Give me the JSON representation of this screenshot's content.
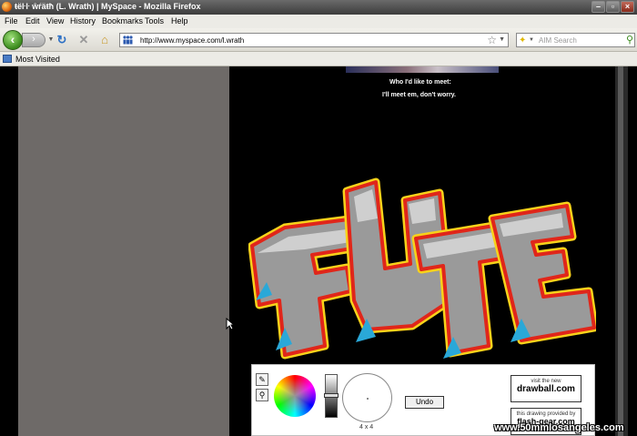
{
  "window": {
    "title": "ŧëŀŀ ŵŕäŧħ (L. Wrath) | MySpace - Mozilla Firefox",
    "buttons": [
      "minimize",
      "restore",
      "close"
    ]
  },
  "menu": [
    "File",
    "Edit",
    "View",
    "History",
    "Bookmarks",
    "Tools",
    "Help"
  ],
  "nav": {
    "url": "http://www.myspace.com/l.wrath",
    "search_placeholder": "AIM Search",
    "icons": [
      "back-arrow-icon",
      "forward-arrow-icon",
      "reload-icon",
      "stop-icon",
      "home-icon",
      "star-icon"
    ]
  },
  "bookmarks": {
    "most_visited": "Most Visited"
  },
  "profile": {
    "heading": "Who I'd like to meet:",
    "body": "I'll meet em, don't worry."
  },
  "graffiti": {
    "text": "FUTE",
    "colors": {
      "fill": "#9a9a9a",
      "outline_red": "#e0261a",
      "outline_yellow": "#f7d21a",
      "shadow": "#2aa8d8"
    }
  },
  "widget": {
    "brush_size": "4 x 4",
    "undo_label": "Undo",
    "promo1_small": "visit the new",
    "promo1_big": "drawball.com",
    "promo2_small": "this drawing provided by",
    "promo2_big": "flash-gear.com"
  },
  "watermark": "www.50mmlosangeles.com"
}
